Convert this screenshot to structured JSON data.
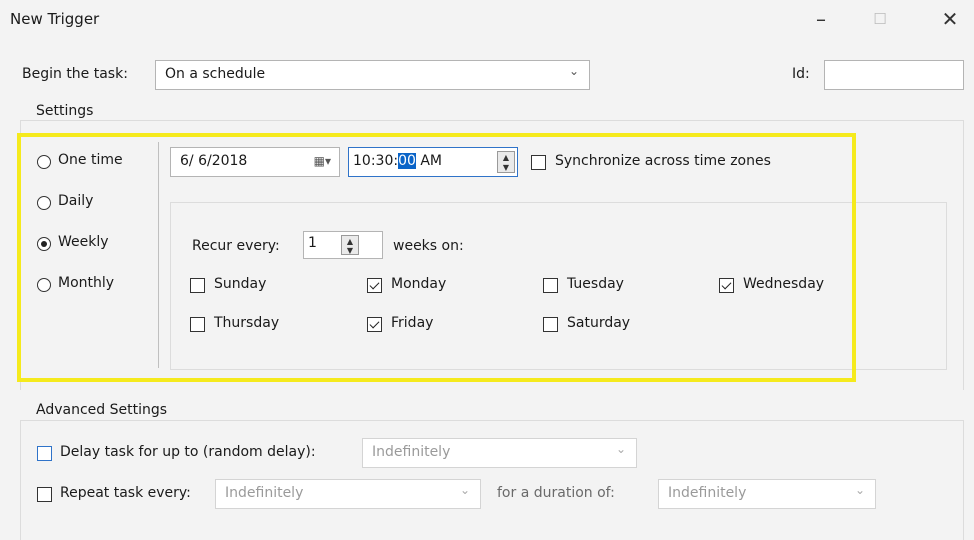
{
  "window": {
    "title": "New Trigger",
    "minimize": "–",
    "maximize": "☐",
    "close": "✕"
  },
  "begin": {
    "label": "Begin the task:",
    "value": "On a schedule",
    "id_label": "Id:",
    "id_value": ""
  },
  "settings": {
    "title": "Settings",
    "radios": [
      {
        "label": "One time",
        "selected": false
      },
      {
        "label": "Daily",
        "selected": false
      },
      {
        "label": "Weekly",
        "selected": true
      },
      {
        "label": "Monthly",
        "selected": false
      }
    ],
    "date": "6/ 6/2018",
    "time_prefix": "10:30:",
    "time_selected": "00",
    "time_suffix": " AM",
    "sync_label": "Synchronize across time zones",
    "recur_label": "Recur every:",
    "recur_value": "1",
    "weeks_on": "weeks on:",
    "days": [
      {
        "label": "Sunday",
        "checked": false
      },
      {
        "label": "Monday",
        "checked": true
      },
      {
        "label": "Tuesday",
        "checked": false
      },
      {
        "label": "Wednesday",
        "checked": true
      },
      {
        "label": "Thursday",
        "checked": false
      },
      {
        "label": "Friday",
        "checked": true
      },
      {
        "label": "Saturday",
        "checked": false
      }
    ]
  },
  "advanced": {
    "title": "Advanced Settings",
    "delay_label": "Delay task for up to (random delay):",
    "delay_value": "Indefinitely",
    "repeat_label": "Repeat task every:",
    "repeat_value": "Indefinitely",
    "duration_label": "for a duration of:",
    "duration_value": "Indefinitely"
  },
  "colors": {
    "highlight": "#f5ea1c",
    "selection": "#0a64c8"
  }
}
